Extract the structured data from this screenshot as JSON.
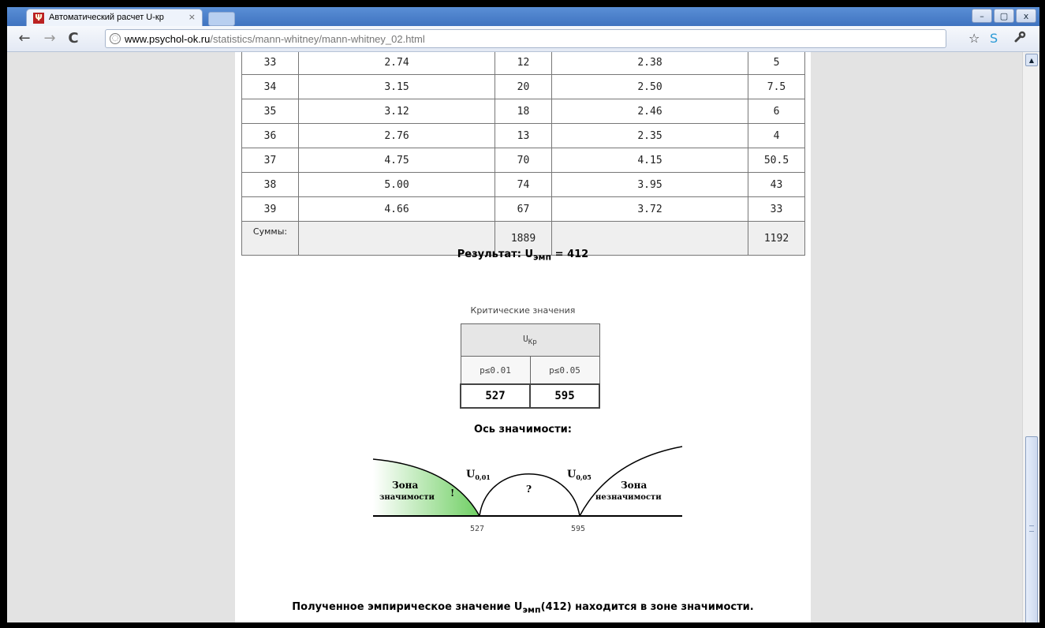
{
  "browser": {
    "tab_title": "Автоматический расчет U-кр",
    "tab_close": "×",
    "favicon": "Ψ",
    "window_buttons": [
      "–",
      "▢",
      "x"
    ],
    "url_host": "www.psychol-ok.ru",
    "url_path": "/statistics/mann-whitney/mann-whitney_02.html",
    "icons": [
      "back-arrow-icon",
      "forward-arrow-icon",
      "reload-icon",
      "globe-icon",
      "star-icon",
      "skype-icon",
      "wrench-icon"
    ]
  },
  "table": {
    "rows": [
      {
        "n": "33",
        "a": "2.74",
        "ra": "12",
        "b": "2.38",
        "rb": "5"
      },
      {
        "n": "34",
        "a": "3.15",
        "ra": "20",
        "b": "2.50",
        "rb": "7.5"
      },
      {
        "n": "35",
        "a": "3.12",
        "ra": "18",
        "b": "2.46",
        "rb": "6"
      },
      {
        "n": "36",
        "a": "2.76",
        "ra": "13",
        "b": "2.35",
        "rb": "4"
      },
      {
        "n": "37",
        "a": "4.75",
        "ra": "70",
        "b": "4.15",
        "rb": "50.5"
      },
      {
        "n": "38",
        "a": "5.00",
        "ra": "74",
        "b": "3.95",
        "rb": "43"
      },
      {
        "n": "39",
        "a": "4.66",
        "ra": "67",
        "b": "3.72",
        "rb": "33"
      }
    ],
    "sums_label": "Суммы:",
    "sum_a": "1889",
    "sum_b": "1192"
  },
  "result": {
    "prefix": "Результат: U",
    "sub": "эмп",
    "suffix": " = 412"
  },
  "critical": {
    "caption": "Критические значения",
    "header_main": "U",
    "header_sub": "Кр",
    "p1": "p≤0.01",
    "p2": "p≤0.05",
    "v1": "527",
    "v2": "595"
  },
  "axis": {
    "title": "Ось значимости:",
    "zone_sig_1": "Зона",
    "zone_sig_2": "значимости",
    "zone_sig_mark": "!",
    "zone_unk": "?",
    "zone_nonsig_1": "Зона",
    "zone_nonsig_2": "незначимости",
    "u1_main": "U",
    "u1_sub": "0,01",
    "u2_main": "U",
    "u2_sub": "0,05",
    "tick1": "527",
    "tick2": "595",
    "colors": {
      "significance_zone": "#6fcf63"
    }
  },
  "conclusion": {
    "part1": "Полученное эмпирическое значение U",
    "sub": "эмп",
    "part2": "(412) находится в зоне значимости."
  }
}
